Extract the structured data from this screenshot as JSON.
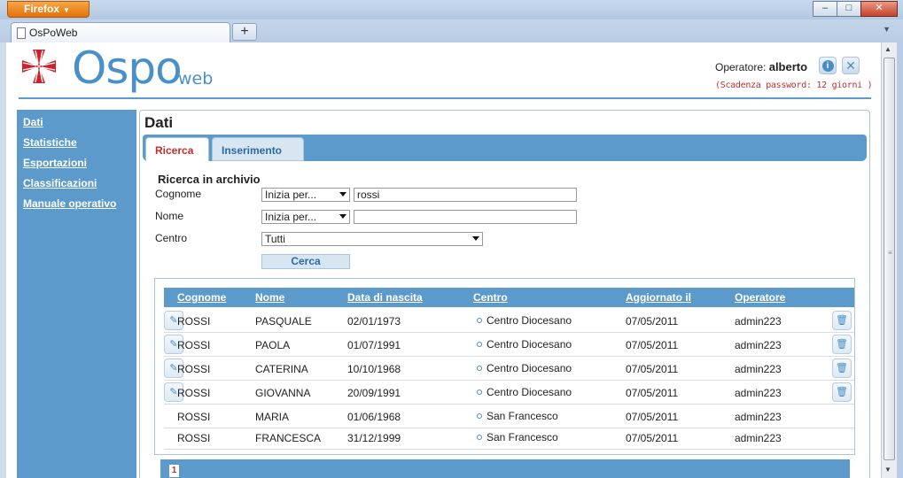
{
  "browser": {
    "app_button": "Firefox",
    "tab_title": "OsPoWeb",
    "new_tab": "+",
    "minimize": "–",
    "maximize": "□",
    "close": "✕"
  },
  "header": {
    "logo_main": "Ospo",
    "logo_sub": "web",
    "operator_label": "Operatore:",
    "operator_name": "alberto",
    "password_note": "(Scadenza password: 12 giorni )",
    "info_icon": "info-icon",
    "logout_icon": "close-icon"
  },
  "sidebar": {
    "items": [
      {
        "label": "Dati"
      },
      {
        "label": "Statistiche"
      },
      {
        "label": "Esportazioni"
      },
      {
        "label": "Classificazioni"
      },
      {
        "label": "Manuale operativo"
      }
    ]
  },
  "main": {
    "title": "Dati",
    "tabs": [
      {
        "label": "Ricerca",
        "active": true
      },
      {
        "label": "Inserimento",
        "active": false
      }
    ],
    "form": {
      "title": "Ricerca in archivio",
      "cognome_label": "Cognome",
      "cognome_mode": "Inizia per...",
      "cognome_value": "rossi",
      "nome_label": "Nome",
      "nome_mode": "Inizia per...",
      "nome_value": "",
      "centro_label": "Centro",
      "centro_value": "Tutti",
      "search_button": "Cerca"
    },
    "grid": {
      "headers": [
        "Cognome",
        "Nome",
        "Data di nascita",
        "Centro",
        "Aggiornato il",
        "Operatore"
      ],
      "rows": [
        {
          "cognome": "ROSSI",
          "nome": "PASQUALE",
          "nascita": "02/01/1973",
          "centro": "Centro Diocesano",
          "aggiornato": "07/05/2011",
          "operatore": "admin223",
          "editable": true
        },
        {
          "cognome": "ROSSI",
          "nome": "PAOLA",
          "nascita": "01/07/1991",
          "centro": "Centro Diocesano",
          "aggiornato": "07/05/2011",
          "operatore": "admin223",
          "editable": true
        },
        {
          "cognome": "ROSSI",
          "nome": "CATERINA",
          "nascita": "10/10/1968",
          "centro": "Centro Diocesano",
          "aggiornato": "07/05/2011",
          "operatore": "admin223",
          "editable": true
        },
        {
          "cognome": "ROSSI",
          "nome": "GIOVANNA",
          "nascita": "20/09/1991",
          "centro": "Centro Diocesano",
          "aggiornato": "07/05/2011",
          "operatore": "admin223",
          "editable": true
        },
        {
          "cognome": "ROSSI",
          "nome": "MARIA",
          "nascita": "01/06/1968",
          "centro": "San Francesco",
          "aggiornato": "07/05/2011",
          "operatore": "admin223",
          "editable": false
        },
        {
          "cognome": "ROSSI",
          "nome": "FRANCESCA",
          "nascita": "31/12/1999",
          "centro": "San Francesco",
          "aggiornato": "07/05/2011",
          "operatore": "admin223",
          "editable": false
        }
      ]
    },
    "pager": {
      "current_page": "1"
    }
  },
  "colors": {
    "brand_blue": "#5b9acb",
    "logo_blue": "#4a90c8",
    "accent_red": "#c0302a",
    "caritas_red": "#d0202a"
  }
}
